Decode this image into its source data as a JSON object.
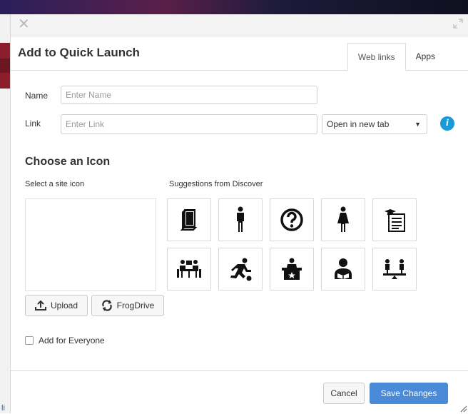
{
  "dialog": {
    "title": "Add to Quick Launch",
    "tabs": [
      {
        "label": "Web links",
        "active": true
      },
      {
        "label": "Apps",
        "active": false
      }
    ]
  },
  "form": {
    "name_label": "Name",
    "name_placeholder": "Enter Name",
    "link_label": "Link",
    "link_placeholder": "Enter Link",
    "open_select_value": "Open in new tab",
    "info_glyph": "i"
  },
  "icons": {
    "section_title": "Choose an Icon",
    "site_icon_label": "Select a site icon",
    "suggestions_label": "Suggestions from Discover",
    "upload_label": "Upload",
    "frogdrive_label": "FrogDrive",
    "suggestions": [
      "book-icon",
      "man-icon",
      "question-icon",
      "woman-icon",
      "certificate-list-icon",
      "meeting-icon",
      "runner-icon",
      "reception-desk-icon",
      "reader-icon",
      "balance-icon"
    ]
  },
  "options": {
    "add_for_everyone_label": "Add for Everyone"
  },
  "footer": {
    "cancel_label": "Cancel",
    "save_label": "Save Changes"
  },
  "background": {
    "edge_link_text": "li"
  },
  "colors": {
    "primary": "#4a8ad6",
    "info": "#1a9ad6"
  }
}
